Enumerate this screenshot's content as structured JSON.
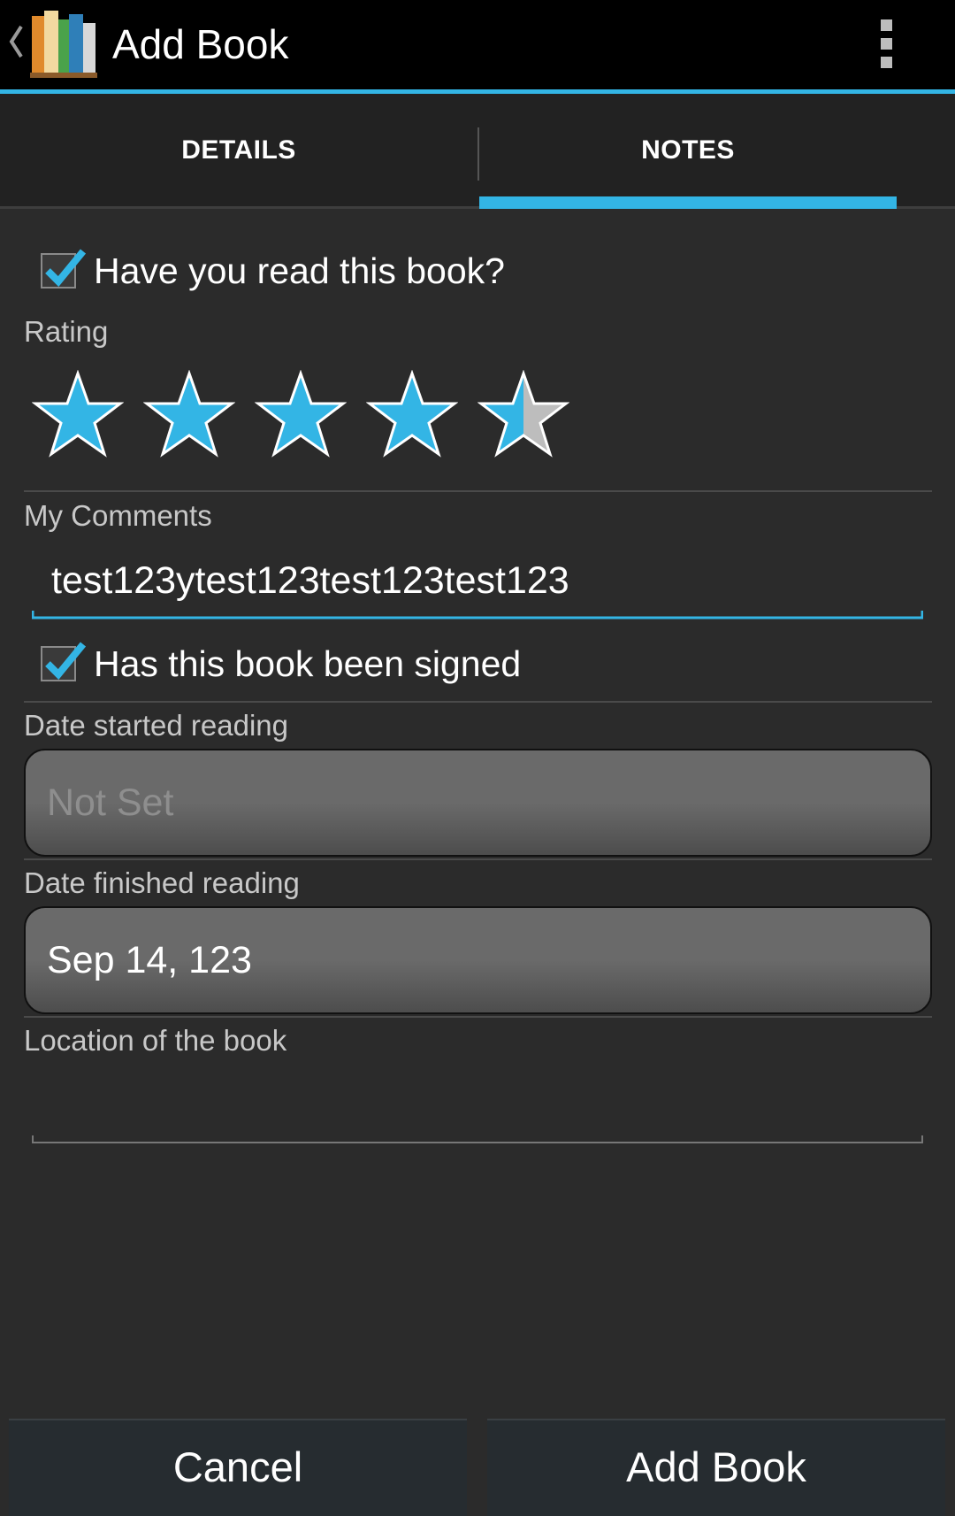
{
  "action_bar": {
    "title": "Add Book"
  },
  "tabs": [
    {
      "label": "DETAILS",
      "selected": false
    },
    {
      "label": "NOTES",
      "selected": true
    }
  ],
  "read_checkbox": {
    "label": "Have you read this book?",
    "checked": true
  },
  "rating": {
    "label": "Rating",
    "value": 4.5,
    "max": 5
  },
  "comments": {
    "label": "My Comments",
    "value": "test123ytest123test123test123"
  },
  "signed_checkbox": {
    "label": "Has this book been signed",
    "checked": true
  },
  "date_started": {
    "label": "Date started reading",
    "value": "Not Set"
  },
  "date_finished": {
    "label": "Date finished reading",
    "value": "Sep 14, 123"
  },
  "location": {
    "label": "Location of the book",
    "value": ""
  },
  "buttons": {
    "cancel": "Cancel",
    "add": "Add Book"
  },
  "colors": {
    "accent": "#33b5e5",
    "background": "#2b2b2b",
    "star_empty": "#bdbdbd"
  }
}
